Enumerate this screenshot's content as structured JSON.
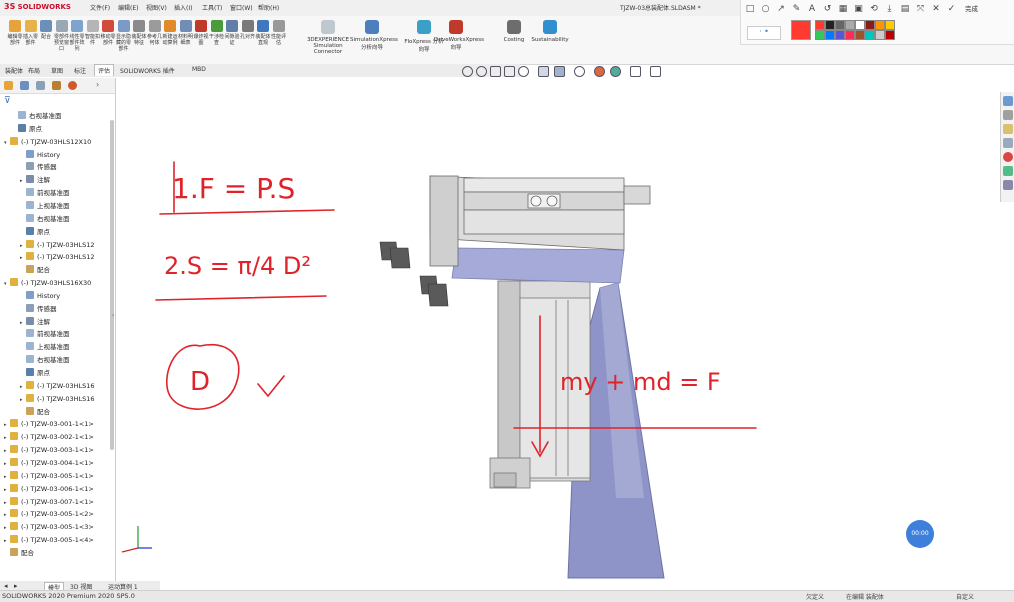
{
  "app": {
    "brand": "SOLIDWORKS",
    "document_title": "TJZW-03总装配体.SLDASM *"
  },
  "menu": [
    "文件(F)",
    "编辑(E)",
    "视图(V)",
    "插入(I)",
    "工具(T)",
    "窗口(W)",
    "帮助(H)"
  ],
  "ribbon": {
    "small_buttons": [
      {
        "label": "编辑零部件",
        "color": "#e7a23a"
      },
      {
        "label": "插入零部件",
        "color": "#e8b24a"
      },
      {
        "label": "配合",
        "color": "#6b8fb8"
      },
      {
        "label": "零部件预览窗口",
        "color": "#9aa7b5"
      },
      {
        "label": "线性零部件阵列",
        "color": "#7fa3cf"
      },
      {
        "label": "智能扣件",
        "color": "#b5b5b5"
      },
      {
        "label": "移动零部件",
        "color": "#d24a3a"
      },
      {
        "label": "显示隐藏的零部件",
        "color": "#7b9bc6"
      },
      {
        "label": "装配体特征",
        "color": "#8a8a8a"
      },
      {
        "label": "参考几何体",
        "color": "#9b9b9b"
      },
      {
        "label": "新建运动算例",
        "color": "#e08a2a"
      },
      {
        "label": "材料明细表",
        "color": "#6f8db5"
      },
      {
        "label": "爆炸视图",
        "color": "#c0392b"
      },
      {
        "label": "干涉检查",
        "color": "#4b9a3b"
      },
      {
        "label": "间隙验证",
        "color": "#5f7fa8"
      },
      {
        "label": "孔对齐",
        "color": "#7a7a7a"
      },
      {
        "label": "装配体直观",
        "color": "#4078c0"
      },
      {
        "label": "性能评估",
        "color": "#999999"
      }
    ],
    "big_buttons": [
      {
        "label": "3DEXPERIENCE Simulation Connector",
        "color": "#bfc7cf"
      },
      {
        "label": "SimulationXpress 分析向导",
        "color": "#4d7fbf"
      },
      {
        "label": "FloXpress 分析向导",
        "color": "#3aa0c8"
      },
      {
        "label": "DriveWorksXpress 向导",
        "color": "#c0392b"
      },
      {
        "label": "Costing",
        "color": "#6d6d6d"
      },
      {
        "label": "Sustainability",
        "color": "#2f8fcf"
      }
    ]
  },
  "tabs": [
    "装配体",
    "布局",
    "草图",
    "标注",
    "评估",
    "SOLIDWORKS 插件",
    "MBD"
  ],
  "active_tab": "评估",
  "annotation_toolbar": {
    "tools": [
      "□",
      "○",
      "↗",
      "✎",
      "A",
      "↺",
      "▦",
      "▣",
      "⟲",
      "⤓",
      "▤",
      "⤧",
      "✕",
      "✓"
    ],
    "done_label": "完成",
    "size_label": "· •",
    "swatches": [
      "#ff3b30",
      "#222222",
      "#666666",
      "#aaaaaa",
      "#ffffff",
      "#8b1a1a",
      "#ff9500",
      "#ffcc00",
      "#34c759",
      "#007aff",
      "#5856d6",
      "#ff2d55",
      "#a0522d",
      "#00c7be",
      "#cccccc",
      "#bb0000"
    ]
  },
  "tree": [
    {
      "label": "右视基准面",
      "icon": "plane",
      "indent": 1,
      "expander": ""
    },
    {
      "label": "原点",
      "icon": "origin",
      "indent": 1,
      "expander": ""
    },
    {
      "label": "(-) TJZW-03HLS12X10",
      "icon": "part",
      "indent": 0,
      "expander": "▾"
    },
    {
      "label": "History",
      "icon": "history",
      "indent": 2,
      "expander": ""
    },
    {
      "label": "传感器",
      "icon": "sensor",
      "indent": 2,
      "expander": ""
    },
    {
      "label": "注解",
      "icon": "annot",
      "indent": 2,
      "expander": "▸"
    },
    {
      "label": "前视基准面",
      "icon": "plane",
      "indent": 2,
      "expander": ""
    },
    {
      "label": "上视基准面",
      "icon": "plane",
      "indent": 2,
      "expander": ""
    },
    {
      "label": "右视基准面",
      "icon": "plane",
      "indent": 2,
      "expander": ""
    },
    {
      "label": "原点",
      "icon": "origin",
      "indent": 2,
      "expander": ""
    },
    {
      "label": "(-) TJZW-03HLS12",
      "icon": "part",
      "indent": 2,
      "expander": "▸"
    },
    {
      "label": "(-) TJZW-03HLS12",
      "icon": "part",
      "indent": 2,
      "expander": "▸"
    },
    {
      "label": "配合",
      "icon": "mates",
      "indent": 2,
      "expander": ""
    },
    {
      "label": "(-) TJZW-03HLS16X30",
      "icon": "part",
      "indent": 0,
      "expander": "▾"
    },
    {
      "label": "History",
      "icon": "history",
      "indent": 2,
      "expander": ""
    },
    {
      "label": "传感器",
      "icon": "sensor",
      "indent": 2,
      "expander": ""
    },
    {
      "label": "注解",
      "icon": "annot",
      "indent": 2,
      "expander": "▸"
    },
    {
      "label": "前视基准面",
      "icon": "plane",
      "indent": 2,
      "expander": ""
    },
    {
      "label": "上视基准面",
      "icon": "plane",
      "indent": 2,
      "expander": ""
    },
    {
      "label": "右视基准面",
      "icon": "plane",
      "indent": 2,
      "expander": ""
    },
    {
      "label": "原点",
      "icon": "origin",
      "indent": 2,
      "expander": ""
    },
    {
      "label": "(-) TJZW-03HLS16",
      "icon": "part",
      "indent": 2,
      "expander": "▸"
    },
    {
      "label": "(-) TJZW-03HLS16",
      "icon": "part",
      "indent": 2,
      "expander": "▸"
    },
    {
      "label": "配合",
      "icon": "mates",
      "indent": 2,
      "expander": ""
    },
    {
      "label": "(-) TJZW-03-001-1<1>",
      "icon": "part",
      "indent": 0,
      "expander": "▸"
    },
    {
      "label": "(-) TJZW-03-002-1<1>",
      "icon": "part",
      "indent": 0,
      "expander": "▸"
    },
    {
      "label": "(-) TJZW-03-003-1<1>",
      "icon": "part",
      "indent": 0,
      "expander": "▸"
    },
    {
      "label": "(-) TJZW-03-004-1<1>",
      "icon": "part",
      "indent": 0,
      "expander": "▸"
    },
    {
      "label": "(-) TJZW-03-005-1<1>",
      "icon": "part",
      "indent": 0,
      "expander": "▸"
    },
    {
      "label": "(-) TJZW-03-006-1<1>",
      "icon": "part",
      "indent": 0,
      "expander": "▸"
    },
    {
      "label": "(-) TJZW-03-007-1<1>",
      "icon": "part",
      "indent": 0,
      "expander": "▸"
    },
    {
      "label": "(-) TJZW-03-005-1<2>",
      "icon": "part",
      "indent": 0,
      "expander": "▸"
    },
    {
      "label": "(-) TJZW-03-005-1<3>",
      "icon": "part",
      "indent": 0,
      "expander": "▸"
    },
    {
      "label": "(-) TJZW-03-005-1<4>",
      "icon": "part",
      "indent": 0,
      "expander": "▸"
    },
    {
      "label": "配合",
      "icon": "mates",
      "indent": 0,
      "expander": ""
    }
  ],
  "bottom_tabs": [
    "模型",
    "3D 视图",
    "运动算例 1"
  ],
  "status": {
    "left": "SOLIDWORKS 2020 Premium 2020 SP5.0",
    "mid1": "欠定义",
    "mid2": "在编辑 装配体",
    "mid3": "自定义"
  },
  "annotations": {
    "eq1": "1.F = P.S",
    "eq2": "2.S = π/4 D²",
    "circle": "D",
    "eq3": "my + md = F"
  },
  "timer": "00:00",
  "colors": {
    "ink": "#e0232a",
    "accent": "#c8102e",
    "viewport_bg": "#ffffff"
  }
}
